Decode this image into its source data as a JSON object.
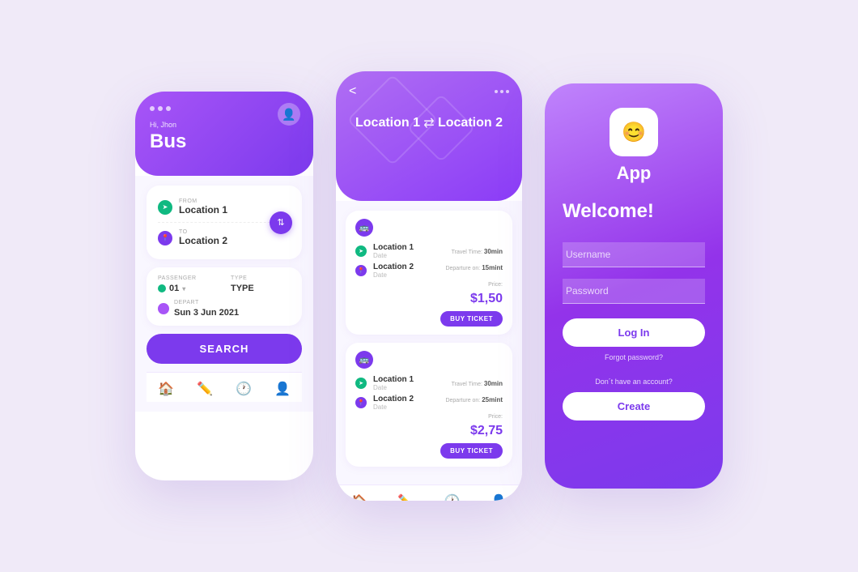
{
  "screen1": {
    "dots": [
      "•",
      "•",
      "•"
    ],
    "greeting": "Hi, Jhon",
    "title": "Bus",
    "from_label": "FROM",
    "from_location": "Location 1",
    "to_label": "TO",
    "to_location": "Location 2",
    "swap_icon": "⇅",
    "passenger_label": "PASSENGER",
    "passenger_value": "01",
    "type_label": "TYPE",
    "type_value": "TYPE",
    "depart_label": "DEPART",
    "depart_value": "Sun 3 Jun 2021",
    "search_label": "SEARCH",
    "nav_icons": [
      "🏠",
      "✏️",
      "🕐",
      "👤"
    ]
  },
  "screen2": {
    "back_icon": "<",
    "dots": [
      "•",
      "•",
      "•"
    ],
    "location1": "Location 1",
    "location2": "Location 2",
    "swap_icon": "⇄",
    "tickets": [
      {
        "bus_icon": "🚌",
        "from": "Location 1",
        "from_date": "Date",
        "to": "Location 2",
        "to_date": "Date",
        "travel_time_label": "Travel Time:",
        "travel_time": "30min",
        "departure_label": "Departure on:",
        "departure": "15mint",
        "price_label": "Price:",
        "price": "$1,50",
        "buy_label": "BUY TICKET"
      },
      {
        "bus_icon": "🚌",
        "from": "Location 1",
        "from_date": "Date",
        "to": "Location 2",
        "to_date": "Date",
        "travel_time_label": "Travel Time:",
        "travel_time": "30min",
        "departure_label": "Departure on:",
        "departure": "25mint",
        "price_label": "Price:",
        "price": "$2,75",
        "buy_label": "BUY TICKET"
      }
    ],
    "nav_icons": [
      "🏠",
      "✏️",
      "🕐",
      "👤"
    ]
  },
  "screen3": {
    "app_icon": "😊",
    "app_name": "App",
    "welcome": "Welcome!",
    "username_placeholder": "Username",
    "password_placeholder": "Password",
    "login_label": "Log In",
    "forgot_label": "Forgot password?",
    "dont_have": "Don´t have an account?",
    "create_label": "Create"
  }
}
